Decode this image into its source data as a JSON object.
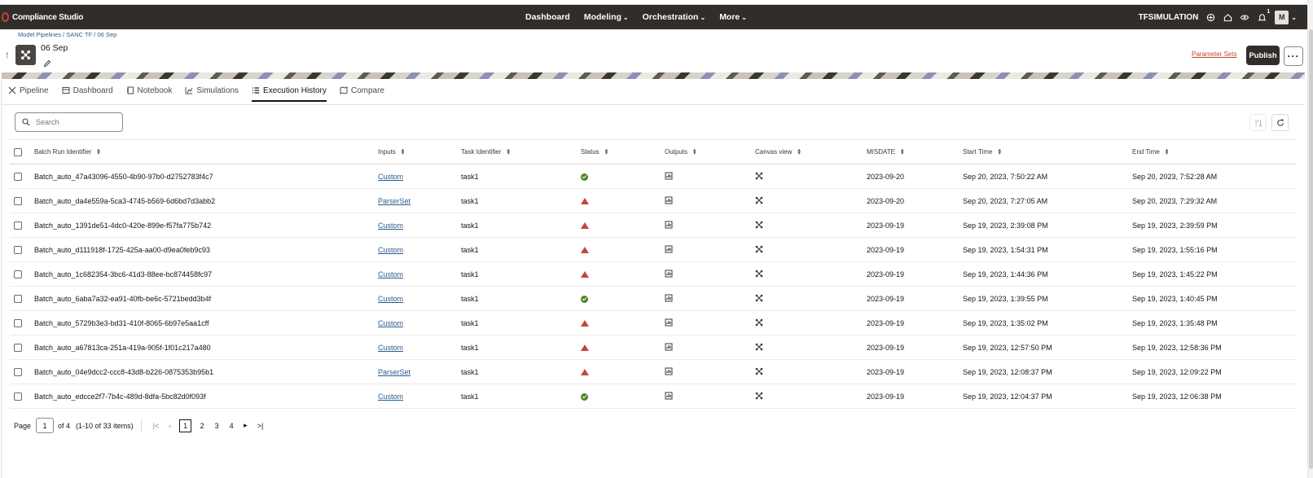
{
  "app": {
    "name": "Compliance Studio",
    "nav": [
      {
        "label": "Dashboard",
        "dropdown": false
      },
      {
        "label": "Modeling",
        "dropdown": true
      },
      {
        "label": "Orchestration",
        "dropdown": true
      },
      {
        "label": "More",
        "dropdown": true
      }
    ],
    "user_label": "TFSIMULATION",
    "avatar_initial": "M",
    "notification_count": "1"
  },
  "breadcrumb": {
    "items": [
      "Model Pipelines",
      "SANC TF",
      "06 Sep"
    ],
    "separator": "/"
  },
  "header": {
    "title": "06 Sep",
    "parameter_sets_label": "Parameter Sets",
    "publish_label": "Publish",
    "more_label": "···"
  },
  "tabs": [
    {
      "label": "Pipeline",
      "icon": "pipeline-icon",
      "active": false
    },
    {
      "label": "Dashboard",
      "icon": "dashboard-icon",
      "active": false
    },
    {
      "label": "Notebook",
      "icon": "notebook-icon",
      "active": false
    },
    {
      "label": "Simulations",
      "icon": "chart-icon",
      "active": false
    },
    {
      "label": "Execution History",
      "icon": "list-icon",
      "active": true
    },
    {
      "label": "Compare",
      "icon": "compare-icon",
      "active": false
    }
  ],
  "search": {
    "placeholder": "Search",
    "value": ""
  },
  "table": {
    "columns": [
      "Batch Run Identifier",
      "Inputs",
      "Task Identifier",
      "Status",
      "Outputs",
      "Canvas view",
      "MISDATE",
      "Start Time",
      "End Time"
    ],
    "rows": [
      {
        "id": "Batch_auto_47a43096-4550-4b90-97b0-d2752783f4c7",
        "inputs": "Custom",
        "task": "task1",
        "status": "success",
        "misdate": "2023-09-20",
        "start": "Sep 20, 2023, 7:50:22 AM",
        "end": "Sep 20, 2023, 7:52:28 AM"
      },
      {
        "id": "Batch_auto_da4e559a-5ca3-4745-b569-6d6bd7d3abb2",
        "inputs": "ParserSet",
        "task": "task1",
        "status": "failed",
        "misdate": "2023-09-20",
        "start": "Sep 20, 2023, 7:27:05 AM",
        "end": "Sep 20, 2023, 7:29:32 AM"
      },
      {
        "id": "Batch_auto_1391de51-4dc0-420e-899e-f57fa775b742",
        "inputs": "Custom",
        "task": "task1",
        "status": "failed",
        "misdate": "2023-09-19",
        "start": "Sep 19, 2023, 2:39:08 PM",
        "end": "Sep 19, 2023, 2:39:59 PM"
      },
      {
        "id": "Batch_auto_d111918f-1725-425a-aa00-d9ea0feb9c93",
        "inputs": "Custom",
        "task": "task1",
        "status": "failed",
        "misdate": "2023-09-19",
        "start": "Sep 19, 2023, 1:54:31 PM",
        "end": "Sep 19, 2023, 1:55:16 PM"
      },
      {
        "id": "Batch_auto_1c682354-3bc6-41d3-88ee-bc874458fc97",
        "inputs": "Custom",
        "task": "task1",
        "status": "failed",
        "misdate": "2023-09-19",
        "start": "Sep 19, 2023, 1:44:36 PM",
        "end": "Sep 19, 2023, 1:45:22 PM"
      },
      {
        "id": "Batch_auto_6aba7a32-ea91-40fb-be6c-5721bedd3b4f",
        "inputs": "Custom",
        "task": "task1",
        "status": "success",
        "misdate": "2023-09-19",
        "start": "Sep 19, 2023, 1:39:55 PM",
        "end": "Sep 19, 2023, 1:40:45 PM"
      },
      {
        "id": "Batch_auto_5729b3e3-bd31-410f-8065-6b97e5aa1cff",
        "inputs": "Custom",
        "task": "task1",
        "status": "failed",
        "misdate": "2023-09-19",
        "start": "Sep 19, 2023, 1:35:02 PM",
        "end": "Sep 19, 2023, 1:35:48 PM"
      },
      {
        "id": "Batch_auto_a67813ca-251a-419a-905f-1f01c217a480",
        "inputs": "Custom",
        "task": "task1",
        "status": "failed",
        "misdate": "2023-09-19",
        "start": "Sep 19, 2023, 12:57:50 PM",
        "end": "Sep 19, 2023, 12:58:36 PM"
      },
      {
        "id": "Batch_auto_04e9dcc2-ccc8-43d8-b226-0875353b95b1",
        "inputs": "ParserSet",
        "task": "task1",
        "status": "failed",
        "misdate": "2023-09-19",
        "start": "Sep 19, 2023, 12:08:37 PM",
        "end": "Sep 19, 2023, 12:09:22 PM"
      },
      {
        "id": "Batch_auto_edcce2f7-7b4c-489d-8dfa-5bc82d0f093f",
        "inputs": "Custom",
        "task": "task1",
        "status": "success",
        "misdate": "2023-09-19",
        "start": "Sep 19, 2023, 12:04:37 PM",
        "end": "Sep 19, 2023, 12:06:38 PM"
      }
    ]
  },
  "pagination": {
    "page_label": "Page",
    "current_page": "1",
    "of_label": "of 4",
    "items_label": "(1-10 of 33 items)",
    "pages": [
      "1",
      "2",
      "3",
      "4"
    ]
  },
  "colors": {
    "appbar": "#312d2a",
    "link": "#2a5c8a",
    "accent_red": "#c74634",
    "success_green": "#508223"
  }
}
